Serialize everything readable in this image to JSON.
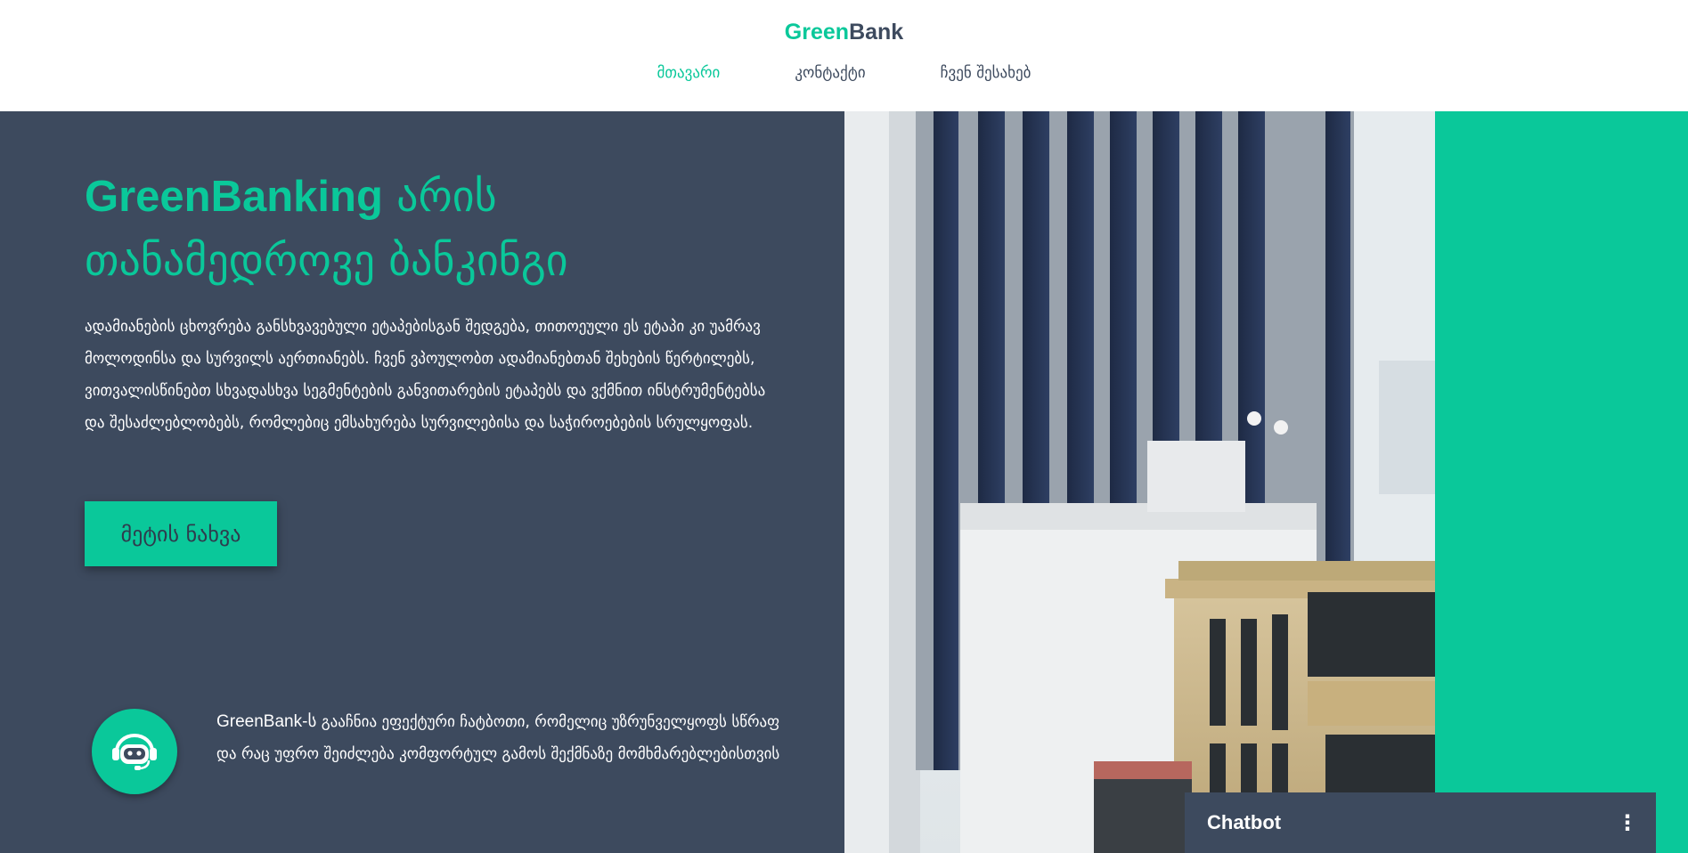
{
  "header": {
    "logo_green": "Green",
    "logo_dark": "Bank",
    "nav": [
      {
        "label": "მთავარი",
        "active": true
      },
      {
        "label": "კონტაქტი",
        "active": false
      },
      {
        "label": "ჩვენ შესახებ",
        "active": false
      }
    ]
  },
  "hero": {
    "title_strong": "GreenBanking",
    "title_rest_1": " არის",
    "title_rest_2": "თანამედროვე ბანკინგი",
    "text": "ადამიანების ცხოვრება განსხვავებული ეტაპებისგან შედგება, თითოეული ეს ეტაპი კი უამრავ მოლოდინსა და სურვილს აერთიანებს. ჩვენ ვპოულობთ ადამიანებთან შეხების წერტილებს, ვითვალისწინებთ სხვადასხვა სეგმენტების განვითარების ეტაპებს და ვქმნით ინსტრუმენტებსა და შესაძლებლობებს, რომლებიც ემსახურება სურვილებისა და საჭიროებების სრულყოფას.",
    "button_label": "მეტის ნახვა"
  },
  "bot_section": {
    "brand": "GreenBank-ს",
    "text": " გააჩნია ეფექტური ჩატბოთი, რომელიც უზრუნველყოფს სწრაფ და რაც უფრო შეიძლება კომფორტულ გამოს შექმნაზე მომხმარებლებისთვის",
    "icon": "robot-icon"
  },
  "chatbot": {
    "title": "Chatbot",
    "menu_icon": "⋮"
  },
  "colors": {
    "accent": "#0ac89a",
    "dark": "#3d4a5e",
    "white": "#ffffff"
  }
}
